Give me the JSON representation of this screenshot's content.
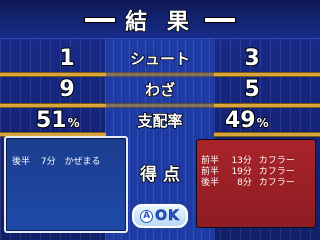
{
  "title": "結 果",
  "stats": {
    "shots": {
      "label": "シュート",
      "home": "1",
      "away": "3"
    },
    "moves": {
      "label": "わざ",
      "home": "9",
      "away": "5"
    },
    "possession": {
      "label": "支配率",
      "home": "51",
      "away": "49",
      "unit": "%"
    }
  },
  "goals_label": "得 点",
  "home_scorers": [
    {
      "half": "後半",
      "minute": "7分",
      "name": "かぜまる"
    }
  ],
  "away_scorers": [
    {
      "half": "前半",
      "minute": "13分",
      "name": "カフラー"
    },
    {
      "half": "前半",
      "minute": "19分",
      "name": "カフラー"
    },
    {
      "half": "後半",
      "minute": "8分",
      "name": "カフラー"
    }
  ],
  "ok_button": {
    "icon_letter": "A",
    "label": "OK"
  },
  "colors": {
    "background": "#15257e",
    "rail": "#d8a63a",
    "home_panel": "#1e4aa8",
    "away_panel": "#a8242a"
  }
}
